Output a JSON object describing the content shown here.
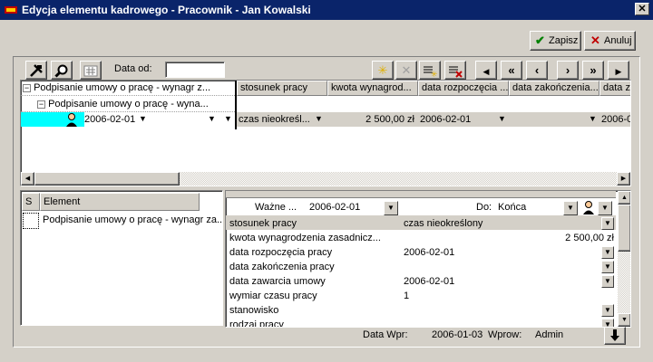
{
  "window": {
    "title": "Edycja elementu kadrowego - Pracownik - Jan Kowalski",
    "close": "✕"
  },
  "actions": {
    "save": "Zapisz",
    "cancel": "Anuluj"
  },
  "toolbar": {
    "data_od_label": "Data od:",
    "data_od_value": ""
  },
  "grid": {
    "tree": [
      "Podpisanie umowy o pracę - wynagr z...",
      "Podpisanie umowy o pracę - wyna...",
      "2006-02-01"
    ],
    "headers": [
      "stosunek pracy",
      "kwota wynagrod...",
      "data rozpoczęcia ...",
      "data zakończenia...",
      "data za"
    ],
    "row": [
      "czas nieokreśl...",
      "2 500,00 zł",
      "2006-02-01",
      "",
      "2006-0:"
    ]
  },
  "elements": {
    "header_s": "S",
    "header_element": "Element",
    "items": [
      "Podpisanie umowy o pracę - wynagr za..."
    ]
  },
  "details": {
    "wazne_label": "Ważne ...",
    "wazne_value": "2006-02-01",
    "do_label": "Do:",
    "do_value": "Końca",
    "rows": [
      {
        "label": "stosunek pracy",
        "value": "czas nieokreślony"
      },
      {
        "label": "kwota wynagrodzenia zasadnicz...",
        "value": "2 500,00 zł"
      },
      {
        "label": "data rozpoczęcia pracy",
        "value": "2006-02-01"
      },
      {
        "label": "data zakończenia pracy",
        "value": ""
      },
      {
        "label": "data zawarcia umowy",
        "value": "2006-02-01"
      },
      {
        "label": "wymiar czasu pracy",
        "value": "1"
      },
      {
        "label": "stanowisko",
        "value": ""
      },
      {
        "label": "rodzaj pracy",
        "value": ""
      }
    ]
  },
  "footer": {
    "data_wpr_label": "Data Wpr:",
    "data_wpr_value": "2006-01-03",
    "wprow_label": "Wprow:",
    "wprow_value": "Admin"
  },
  "colors": {
    "titlebar": "#0a246a",
    "selection": "#00ffff",
    "save_check": "#008000",
    "cancel_x": "#c00000"
  }
}
